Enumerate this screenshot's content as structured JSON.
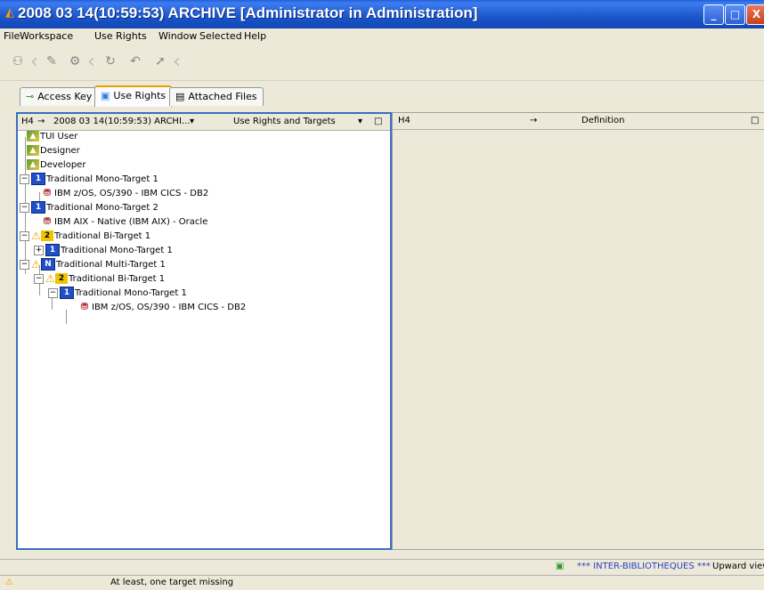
{
  "window": {
    "title": "2008 03 14(10:59:53) ARCHIVE [Administrator in Administration]",
    "minimize_glyph": "_",
    "maximize_glyph": "□",
    "close_glyph": "X"
  },
  "menu": [
    "File",
    "Workspace",
    "Use Rights",
    "Window",
    "Selected",
    "Help"
  ],
  "tabs": [
    {
      "label": "Access Key",
      "icon": "key-icon"
    },
    {
      "label": "Use Rights",
      "icon": "use-rights-icon",
      "active": true
    },
    {
      "label": "Attached Files",
      "icon": "document-icon"
    }
  ],
  "left_panel": {
    "nav_left": "H4",
    "arrow": "→",
    "selector_value": "2008 03 14(10:59:53) ARCHI...",
    "view_select": "Use Rights and Targets",
    "tree": [
      {
        "label": "TUI User",
        "type": "user"
      },
      {
        "label": "Designer",
        "type": "user"
      },
      {
        "label": "Developer",
        "type": "user"
      },
      {
        "label": "Traditional Mono-Target 1",
        "type": "mono",
        "badge": "1"
      },
      {
        "label": "IBM z/OS, OS/390 - IBM CICS - DB2",
        "type": "db"
      },
      {
        "label": "Traditional Mono-Target 2",
        "type": "mono",
        "badge": "1"
      },
      {
        "label": "IBM AIX - Native (IBM AIX) - Oracle",
        "type": "db"
      },
      {
        "label": "Traditional Bi-Target 1",
        "type": "bi",
        "badge": "2"
      },
      {
        "label": "Traditional Mono-Target 1",
        "type": "mono",
        "badge": "1"
      },
      {
        "label": "Traditional Multi-Target 1",
        "type": "multi",
        "badge": "N"
      },
      {
        "label": "Traditional Bi-Target 1",
        "type": "bi",
        "badge": "2"
      },
      {
        "label": "Traditional Mono-Target 1",
        "type": "mono",
        "badge": "1"
      },
      {
        "label": "IBM z/OS, OS/390 - IBM CICS - DB2",
        "type": "db"
      }
    ]
  },
  "right_panel": {
    "nav_left": "H4",
    "arrow": "→",
    "column": "Definition"
  },
  "status": {
    "library": "*** INTER-BIBLIOTHEQUES ***",
    "view": "Upward view",
    "message": "At least, one target missing"
  }
}
